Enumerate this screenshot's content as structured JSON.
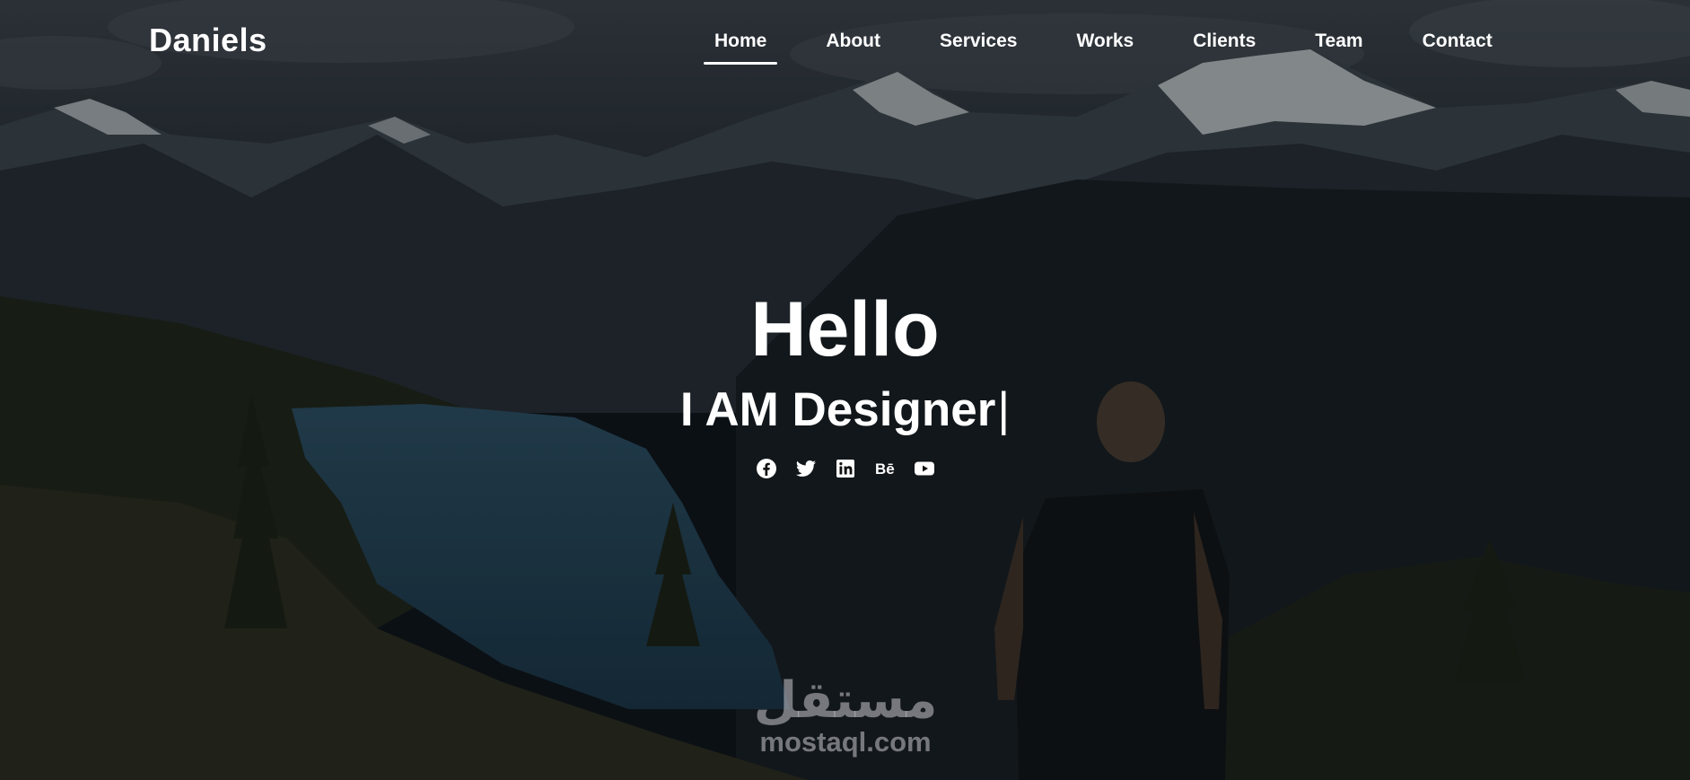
{
  "brand": {
    "name": "Daniels"
  },
  "nav": {
    "items": [
      {
        "label": "Home",
        "active": true
      },
      {
        "label": "About",
        "active": false
      },
      {
        "label": "Services",
        "active": false
      },
      {
        "label": "Works",
        "active": false
      },
      {
        "label": "Clients",
        "active": false
      },
      {
        "label": "Team",
        "active": false
      },
      {
        "label": "Contact",
        "active": false
      }
    ]
  },
  "hero": {
    "title": "Hello",
    "subtitle": "I AM Designer",
    "cursor": "|",
    "socials": [
      {
        "icon": "facebook-icon"
      },
      {
        "icon": "twitter-icon"
      },
      {
        "icon": "linkedin-icon"
      },
      {
        "icon": "behance-icon"
      },
      {
        "icon": "youtube-icon"
      }
    ]
  },
  "watermark": {
    "arabic": "مستقل",
    "domain": "mostaql.com"
  },
  "colors": {
    "text": "#ffffff",
    "overlay": "#0b1118",
    "sky": "#3a4048",
    "lake": "#25455a"
  }
}
